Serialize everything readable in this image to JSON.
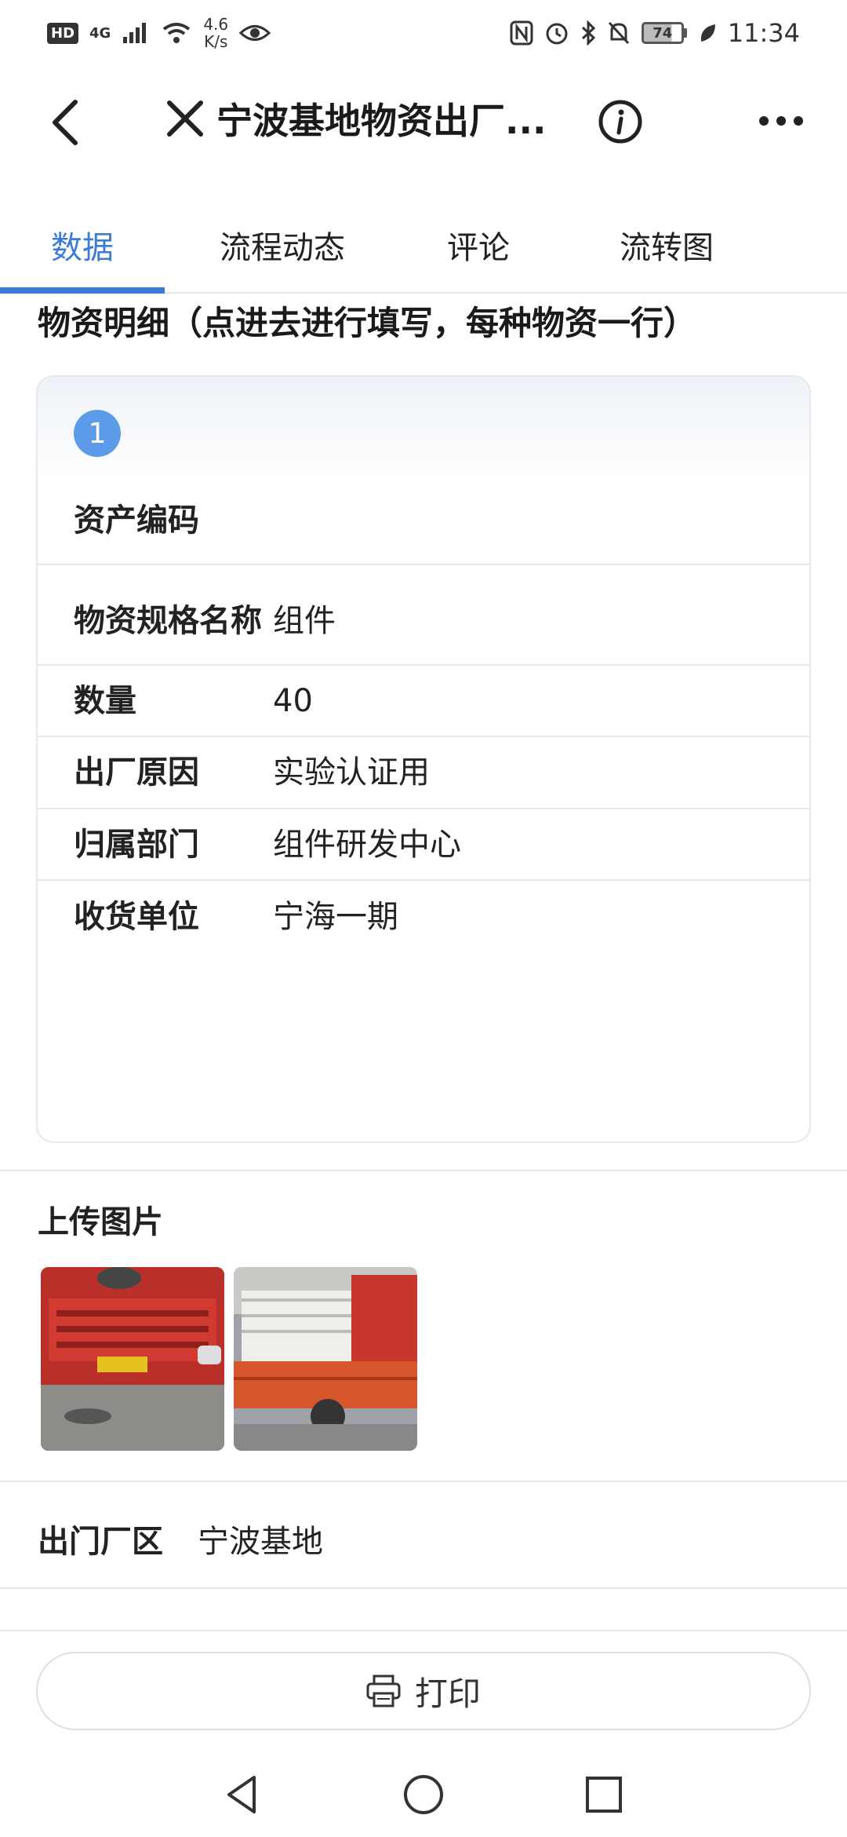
{
  "status_bar": {
    "hd": "HD",
    "network": "4G",
    "speed_value": "4.6",
    "speed_unit": "K/s",
    "battery": "74",
    "time": "11:34",
    "icons": [
      "signal-icon",
      "wifi-icon",
      "eye-icon",
      "nfc-icon",
      "alarm-icon",
      "bluetooth-icon",
      "mute-icon",
      "battery-icon",
      "leaf-icon"
    ]
  },
  "header": {
    "title": "宁波基地物资出厂...",
    "icons": [
      "back-icon",
      "close-icon",
      "info-icon",
      "more-icon"
    ]
  },
  "tabs": [
    {
      "label": "数据",
      "active": true
    },
    {
      "label": "流程动态",
      "active": false
    },
    {
      "label": "评论",
      "active": false
    },
    {
      "label": "流转图",
      "active": false
    }
  ],
  "detail": {
    "section_title": "物资明细（点进去进行填写，每种物资一行）",
    "row_number": "1",
    "first_label": "资产编码",
    "rows": [
      {
        "label": "物资规格名称",
        "value": "组件"
      },
      {
        "label": "数量",
        "value": "40"
      },
      {
        "label": "出厂原因",
        "value": "实验认证用"
      },
      {
        "label": "归属部门",
        "value": "组件研发中心"
      },
      {
        "label": "收货单位",
        "value": "宁海一期"
      }
    ]
  },
  "upload": {
    "label": "上传图片",
    "images": [
      "red-truck-front-photo",
      "truck-cargo-photo"
    ]
  },
  "fields": [
    {
      "label": "出门厂区",
      "value": "宁波基地"
    }
  ],
  "footer": {
    "print_label": "打印"
  },
  "colors": {
    "accent": "#3a7bd5",
    "badge": "#5b9be8",
    "border": "#e6e8ec"
  }
}
